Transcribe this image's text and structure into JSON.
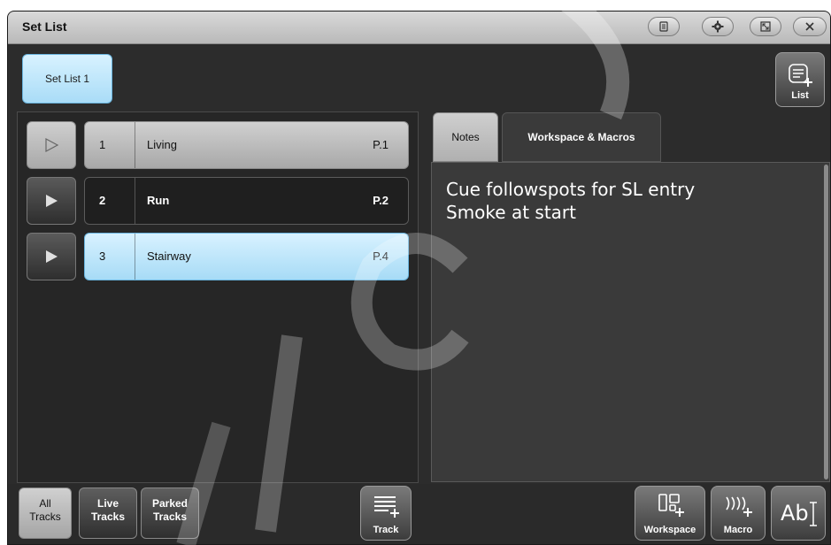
{
  "window": {
    "title": "Set List"
  },
  "titlebar_buttons": [
    {
      "name": "menu-button",
      "icon": "menu-icon"
    },
    {
      "name": "settings-button",
      "icon": "gear-icon"
    },
    {
      "name": "resize-button",
      "icon": "resize-icon"
    },
    {
      "name": "close-button",
      "icon": "close-icon"
    }
  ],
  "set_list_tab": {
    "label": "Set List 1"
  },
  "list_button": {
    "label": "List",
    "icon": "list-add-icon"
  },
  "tracks": [
    {
      "num": "1",
      "name": "Living",
      "page": "P.1",
      "state": "selected-grey"
    },
    {
      "num": "2",
      "name": "Run",
      "page": "P.2",
      "state": "normal"
    },
    {
      "num": "3",
      "name": "Stairway",
      "page": "P.4",
      "state": "selected-blue"
    }
  ],
  "tabs": {
    "notes": "Notes",
    "workspace_macros": "Workspace & Macros"
  },
  "notes": {
    "lines": [
      "Cue followspots for SL entry",
      "Smoke at start"
    ]
  },
  "bottom_filters": [
    {
      "label_line1": "All",
      "label_line2": "Tracks"
    },
    {
      "label_line1": "Live",
      "label_line2": "Tracks"
    },
    {
      "label_line1": "Parked",
      "label_line2": "Tracks"
    }
  ],
  "track_button": {
    "label": "Track",
    "icon": "track-add-icon"
  },
  "workspace_button": {
    "label": "Workspace",
    "icon": "workspace-add-icon"
  },
  "macro_button": {
    "label": "Macro",
    "icon": "macro-add-icon"
  },
  "text_button": {
    "label": "Ab",
    "icon": "text-cursor-icon"
  },
  "colors": {
    "accent_blue": "#a9dcf7",
    "background": "#2c2c2c"
  }
}
